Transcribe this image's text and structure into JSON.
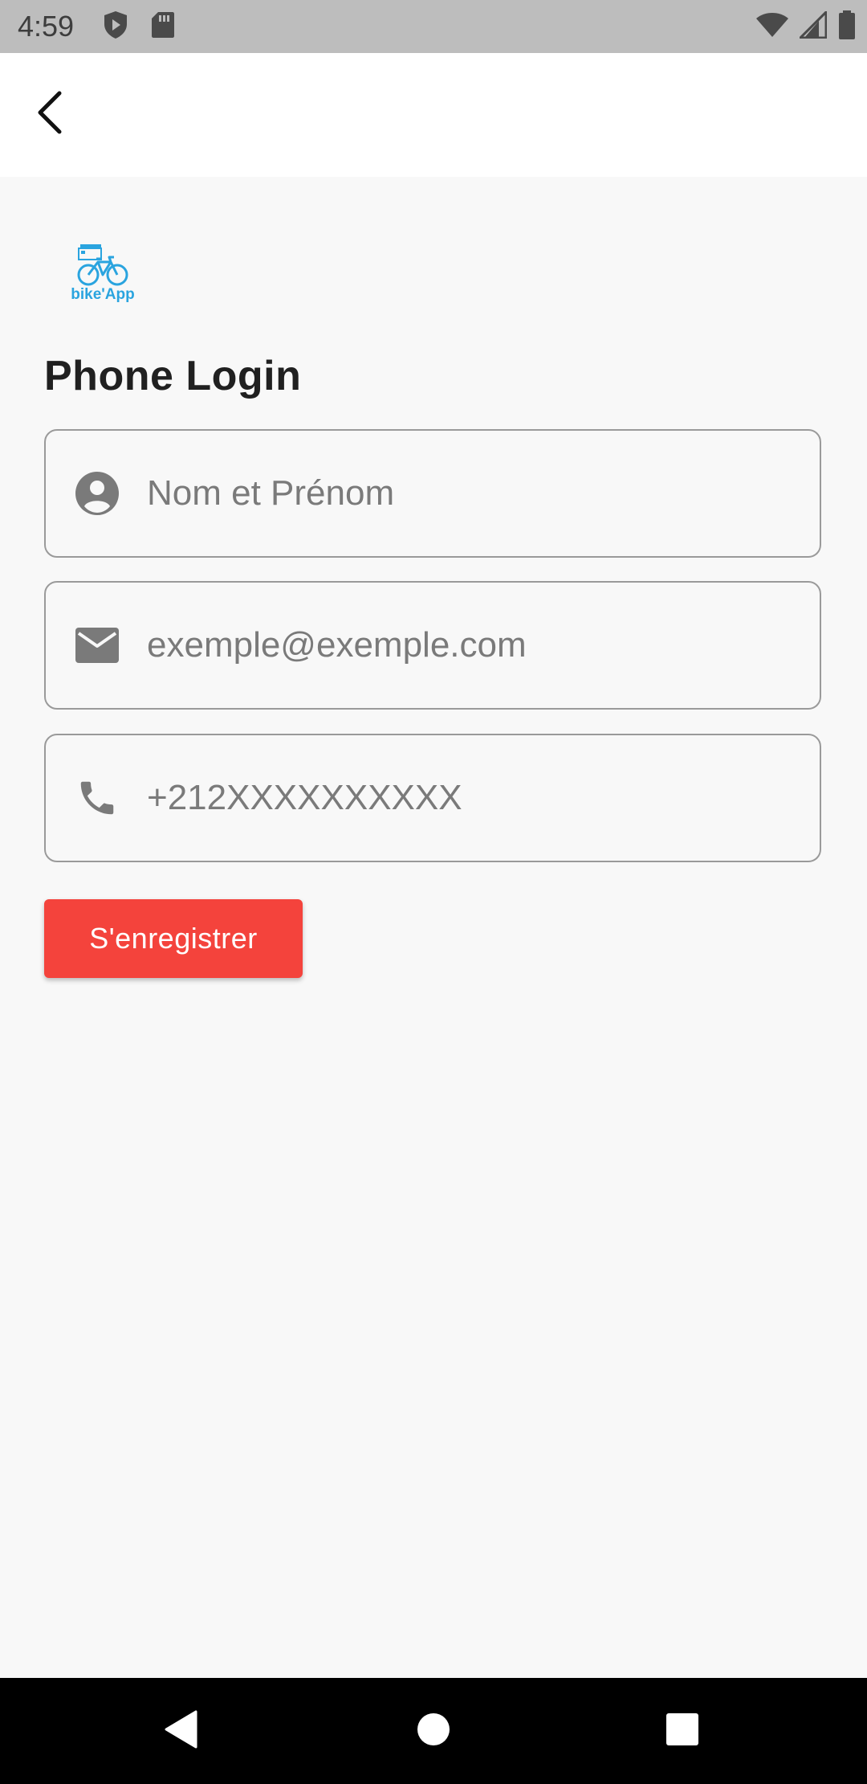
{
  "status_bar": {
    "time": "4:59",
    "left_icons": [
      "play-protect-icon",
      "sd-card-icon"
    ],
    "right_icons": [
      "wifi-icon",
      "cell-signal-icon",
      "battery-icon"
    ]
  },
  "app_bar": {
    "back_icon": "chevron-left-icon"
  },
  "logo": {
    "text": "bike'App",
    "color": "#2aa4df"
  },
  "page": {
    "title": "Phone Login"
  },
  "form": {
    "name": {
      "placeholder": "Nom et Prénom",
      "icon": "account-circle-icon",
      "value": ""
    },
    "email": {
      "placeholder": "exemple@exemple.com",
      "icon": "mail-icon",
      "value": ""
    },
    "phone": {
      "placeholder": "+212XXXXXXXXXX",
      "icon": "phone-icon",
      "value": ""
    },
    "submit_label": "S'enregistrer"
  },
  "colors": {
    "accent": "#f4433c",
    "status_bar": "#bdbdbd",
    "background": "#f8f8f8",
    "nav_bar": "#000000"
  },
  "nav_bar": {
    "buttons": [
      "back-triangle-icon",
      "home-circle-icon",
      "recents-square-icon"
    ]
  }
}
